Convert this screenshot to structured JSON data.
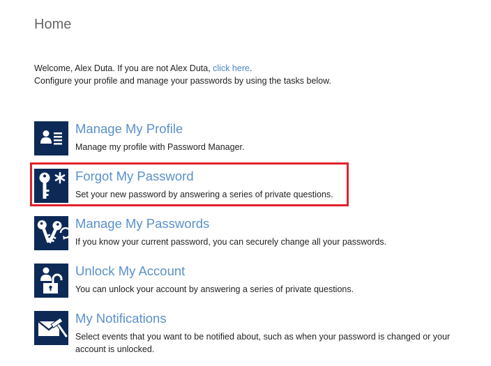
{
  "page": {
    "title": "Home"
  },
  "welcome": {
    "line1_prefix": "Welcome, Alex Duta. If you are not Alex Duta, ",
    "link_text": "click here",
    "line1_suffix": ".",
    "line2": "Configure your profile and manage your passwords by using the tasks below."
  },
  "tasks": [
    {
      "title": "Manage My Profile",
      "description": "Manage my profile with Password Manager.",
      "icon": "profile-card-icon"
    },
    {
      "title": "Forgot My Password",
      "description": "Set your new password by answering a series of private questions.",
      "icon": "key-asterisk-icon",
      "highlighted": true
    },
    {
      "title": "Manage My Passwords",
      "description": "If you know your current password, you can securely change all your passwords.",
      "icon": "keys-icon"
    },
    {
      "title": "Unlock My Account",
      "description": "You can unlock your account by answering a series of private questions.",
      "icon": "user-unlock-icon"
    },
    {
      "title": "My Notifications",
      "description": "Select events that you want to be notified about, such as when your password is changed or your account is unlocked.",
      "icon": "envelope-hammer-icon"
    }
  ],
  "colors": {
    "icon_background": "#0d2a57",
    "link": "#5b91c9",
    "highlight_border": "#e2202c"
  }
}
